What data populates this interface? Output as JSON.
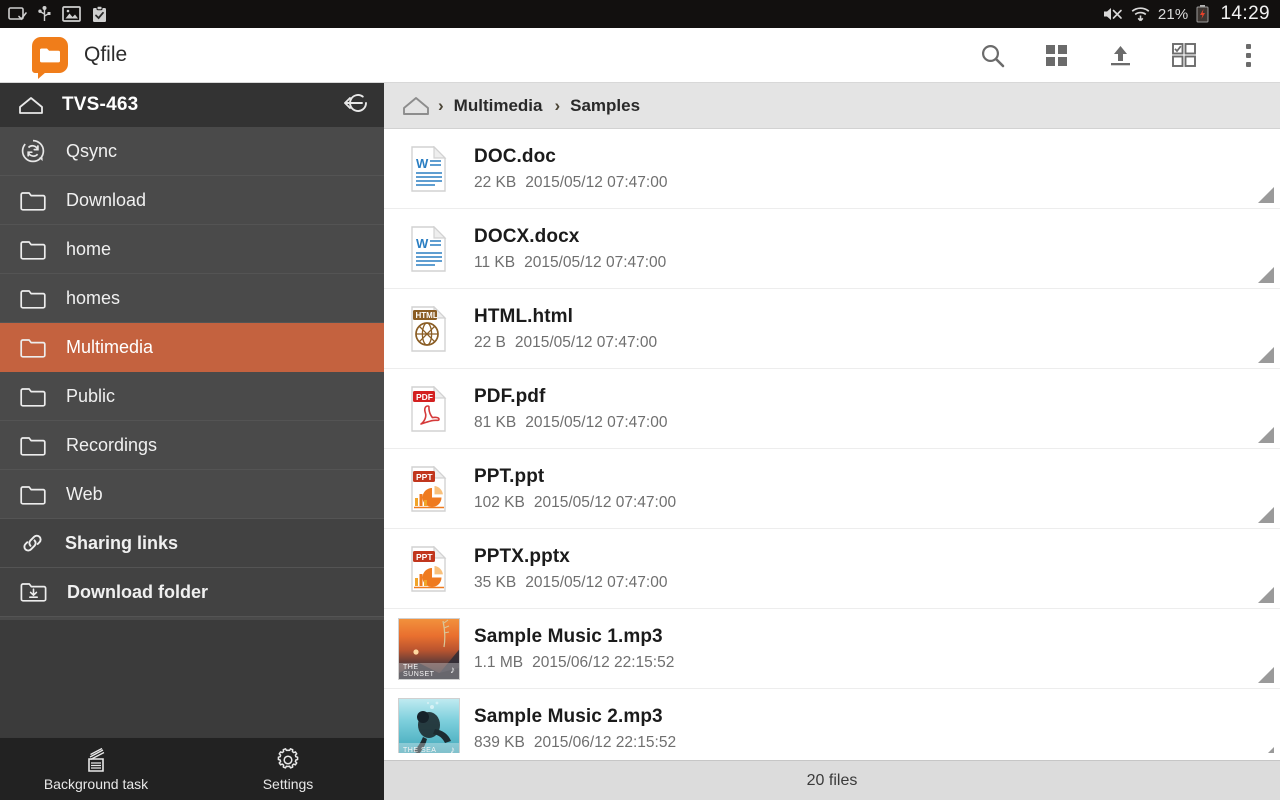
{
  "statusbar": {
    "left_icons": [
      "screencast-icon",
      "usb-icon",
      "image-icon",
      "clipboard-check-icon"
    ],
    "battery_percent": "21%",
    "clock": "14:29",
    "right_icons": [
      "mute-icon",
      "wifi-icon",
      "battery-low-icon"
    ]
  },
  "appbar": {
    "logo_icon": "qfile-logo-icon",
    "title": "Qfile",
    "actions": [
      {
        "name": "search-icon",
        "label": "Search"
      },
      {
        "name": "grid-view-icon",
        "label": "Grid view"
      },
      {
        "name": "upload-icon",
        "label": "Upload"
      },
      {
        "name": "select-mode-icon",
        "label": "Select"
      },
      {
        "name": "overflow-menu-icon",
        "label": "More options"
      }
    ]
  },
  "sidebar": {
    "home_icon": "home-icon",
    "hostname": "TVS-463",
    "logout_icon": "logout-icon",
    "items": [
      {
        "label": "Qsync",
        "icon": "qsync-icon",
        "active": false,
        "bold": false
      },
      {
        "label": "Download",
        "icon": "folder-icon",
        "active": false,
        "bold": false
      },
      {
        "label": "home",
        "icon": "folder-icon",
        "active": false,
        "bold": false
      },
      {
        "label": "homes",
        "icon": "folder-icon",
        "active": false,
        "bold": false
      },
      {
        "label": "Multimedia",
        "icon": "folder-icon",
        "active": true,
        "bold": false
      },
      {
        "label": "Public",
        "icon": "folder-icon",
        "active": false,
        "bold": false
      },
      {
        "label": "Recordings",
        "icon": "folder-icon",
        "active": false,
        "bold": false
      },
      {
        "label": "Web",
        "icon": "folder-icon",
        "active": false,
        "bold": false
      },
      {
        "label": "Sharing links",
        "icon": "link-icon",
        "active": false,
        "bold": true
      },
      {
        "label": "Download folder",
        "icon": "download-folder-icon",
        "active": false,
        "bold": true
      }
    ],
    "bottom": [
      {
        "label": "Background task",
        "icon": "background-task-icon"
      },
      {
        "label": "Settings",
        "icon": "gear-icon"
      }
    ]
  },
  "breadcrumb": {
    "home_icon": "home-outline-icon",
    "separator": "›",
    "path": [
      "Multimedia",
      "Samples"
    ]
  },
  "files": [
    {
      "name": "DOC.doc",
      "size": "22 KB",
      "modified": "2015/05/12 07:47:00",
      "icon": "word-doc-icon"
    },
    {
      "name": "DOCX.docx",
      "size": "11 KB",
      "modified": "2015/05/12 07:47:00",
      "icon": "word-doc-icon"
    },
    {
      "name": "HTML.html",
      "size": "22 B",
      "modified": "2015/05/12 07:47:00",
      "icon": "html-file-icon"
    },
    {
      "name": "PDF.pdf",
      "size": "81 KB",
      "modified": "2015/05/12 07:47:00",
      "icon": "pdf-file-icon"
    },
    {
      "name": "PPT.ppt",
      "size": "102 KB",
      "modified": "2015/05/12 07:47:00",
      "icon": "powerpoint-file-icon"
    },
    {
      "name": "PPTX.pptx",
      "size": "35 KB",
      "modified": "2015/05/12 07:47:00",
      "icon": "powerpoint-file-icon"
    },
    {
      "name": "Sample Music 1.mp3",
      "size": "1.1 MB",
      "modified": "2015/06/12 22:15:52",
      "icon": "album-art-sunset",
      "album_label": "THE SUNSET"
    },
    {
      "name": "Sample Music 2.mp3",
      "size": "839 KB",
      "modified": "2015/06/12 22:15:52",
      "icon": "album-art-sea",
      "album_label": "THE SEA"
    }
  ],
  "footer": {
    "count_label": "20 files"
  },
  "colors": {
    "accent_orange": "#f07d1a",
    "selected_row": "#c4623f",
    "sidebar_bg": "#4a4a4a",
    "sidebar_header": "#333333",
    "breadcrumb_bg": "#e4e4e4",
    "footer_bg": "#dcdcdc"
  }
}
